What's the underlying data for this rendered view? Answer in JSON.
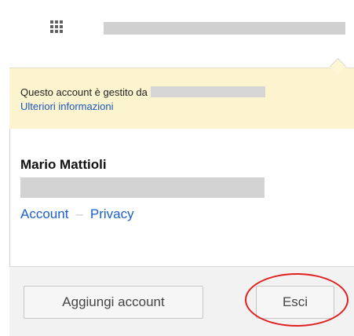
{
  "header": {
    "apps_icon": "grid-apps-icon",
    "account_email_redacted": true
  },
  "managed_notice": {
    "text": "Questo account è gestito da",
    "more_info_link": "Ulteriori informazioni",
    "background_color": "#fcf4cf"
  },
  "user": {
    "name": "Mario Mattioli",
    "email_redacted": true
  },
  "links": {
    "account": "Account",
    "separator": "–",
    "privacy": "Privacy"
  },
  "footer": {
    "add_account_label": "Aggiungi account",
    "signout_label": "Esci"
  },
  "annotation": {
    "highlight_color": "#e0201f",
    "highlighted": "signout-button"
  }
}
